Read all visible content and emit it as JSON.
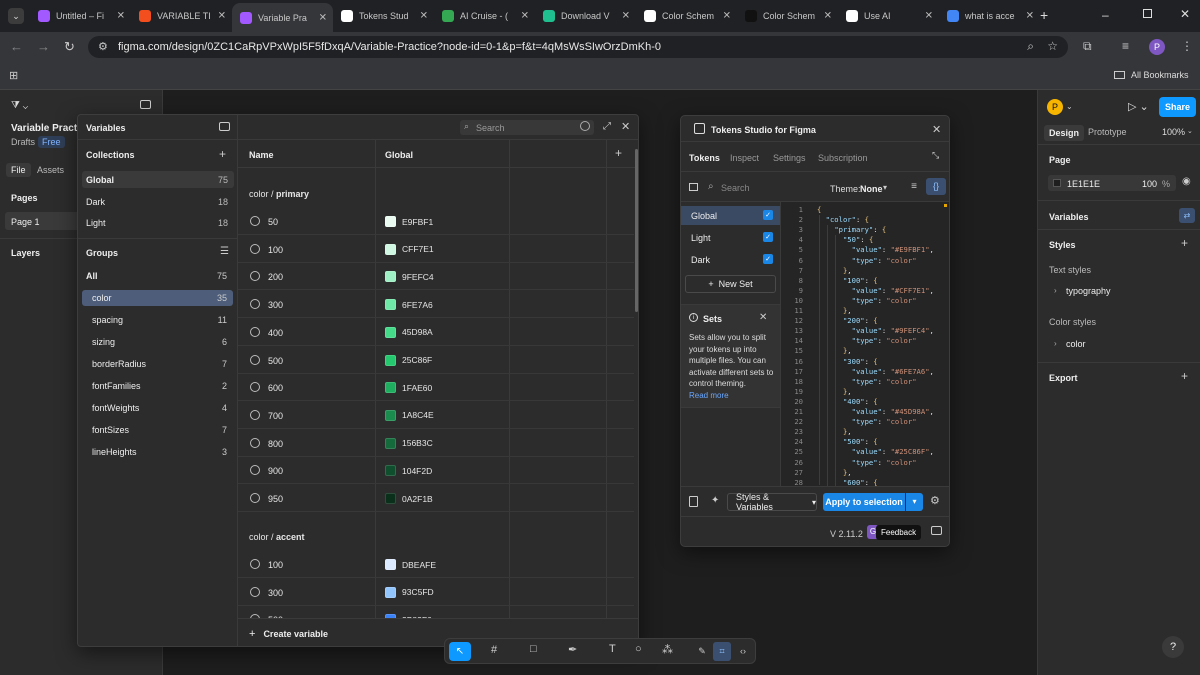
{
  "browser": {
    "tabs": [
      {
        "title": "Untitled – Fi",
        "fav_color": "#a259ff"
      },
      {
        "title": "VARIABLE TI",
        "fav_color": "#f24e1e"
      },
      {
        "title": "Variable Pra",
        "fav_color": "#a259ff",
        "active": true
      },
      {
        "title": "Tokens Stud",
        "fav_color": "#ffffff"
      },
      {
        "title": "AI Cruise - (",
        "fav_color": "#34a853"
      },
      {
        "title": "Download V",
        "fav_color": "#1fbf8f"
      },
      {
        "title": "Color Schem",
        "fav_color": "#ffffff"
      },
      {
        "title": "Color Schem",
        "fav_color": "#111111"
      },
      {
        "title": "Use AI",
        "fav_color": "#ffffff"
      },
      {
        "title": "what is acce",
        "fav_color": "#4285f4"
      }
    ],
    "url": "figma.com/design/0ZC1CaRpVPxWpI5F5fDxqA/Variable-Practice?node-id=0-1&p=f&t=4qMsWsSIwOrzDmKh-0",
    "profile_initial": "P",
    "bookmarks_label": "All Bookmarks"
  },
  "figma_left": {
    "file_name": "Variable Practic",
    "drafts": "Drafts",
    "plan_badge": "Free",
    "tabs": [
      "File",
      "Assets"
    ],
    "pages_label": "Pages",
    "page_item": "Page 1",
    "layers_label": "Layers"
  },
  "variables_modal": {
    "title": "Variables",
    "search_placeholder": "Search",
    "collections_label": "Collections",
    "collections": [
      {
        "name": "Global",
        "count": "75"
      },
      {
        "name": "Dark",
        "count": "18"
      },
      {
        "name": "Light",
        "count": "18"
      }
    ],
    "groups_label": "Groups",
    "groups": [
      {
        "name": "All",
        "count": "75"
      },
      {
        "name": "color",
        "count": "35"
      },
      {
        "name": "spacing",
        "count": "11"
      },
      {
        "name": "sizing",
        "count": "6"
      },
      {
        "name": "borderRadius",
        "count": "7"
      },
      {
        "name": "fontFamilies",
        "count": "2"
      },
      {
        "name": "fontWeights",
        "count": "4"
      },
      {
        "name": "fontSizes",
        "count": "7"
      },
      {
        "name": "lineHeights",
        "count": "3"
      }
    ],
    "col_name": "Name",
    "col_global": "Global",
    "section1_prefix": "color / ",
    "section1_name": "primary",
    "primary": [
      {
        "name": "50",
        "value": "E9FBF1",
        "color": "#E9FBF1"
      },
      {
        "name": "100",
        "value": "CFF7E1",
        "color": "#CFF7E1"
      },
      {
        "name": "200",
        "value": "9FEFC4",
        "color": "#9FEFC4"
      },
      {
        "name": "300",
        "value": "6FE7A6",
        "color": "#6FE7A6"
      },
      {
        "name": "400",
        "value": "45D98A",
        "color": "#45D98A"
      },
      {
        "name": "500",
        "value": "25C86F",
        "color": "#25C86F"
      },
      {
        "name": "600",
        "value": "1FAE60",
        "color": "#1FAE60"
      },
      {
        "name": "700",
        "value": "1A8C4E",
        "color": "#1A8C4E"
      },
      {
        "name": "800",
        "value": "156B3C",
        "color": "#156B3C"
      },
      {
        "name": "900",
        "value": "104F2D",
        "color": "#104F2D"
      },
      {
        "name": "950",
        "value": "0A2F1B",
        "color": "#0A2F1B"
      }
    ],
    "section2_prefix": "color / ",
    "section2_name": "accent",
    "accent": [
      {
        "name": "100",
        "value": "DBEAFE",
        "color": "#DBEAFE"
      },
      {
        "name": "300",
        "value": "93C5FD",
        "color": "#93C5FD"
      },
      {
        "name": "500",
        "value": "3B82F6",
        "color": "#3B82F6"
      }
    ],
    "create_variable": "Create variable"
  },
  "tokens_studio": {
    "title": "Tokens Studio for Figma",
    "tabs": [
      "Tokens",
      "Inspect",
      "Settings",
      "Subscription"
    ],
    "search_placeholder": "Search",
    "theme_label": "Theme:",
    "theme_value": "None",
    "sets": [
      "Global",
      "Light",
      "Dark"
    ],
    "new_set": "New Set",
    "info_title": "Sets",
    "info_text": "Sets allow you to split your tokens up into multiple files. You can activate different sets to control theming.",
    "read_more": "Read more",
    "code_lines": [
      "{",
      "  \"color\": {",
      "    \"primary\": {",
      "      \"50\": {",
      "        \"value\": \"#E9FBF1\",",
      "        \"type\": \"color\"",
      "      },",
      "      \"100\": {",
      "        \"value\": \"#CFF7E1\",",
      "        \"type\": \"color\"",
      "      },",
      "      \"200\": {",
      "        \"value\": \"#9FEFC4\",",
      "        \"type\": \"color\"",
      "      },",
      "      \"300\": {",
      "        \"value\": \"#6FE7A6\",",
      "        \"type\": \"color\"",
      "      },",
      "      \"400\": {",
      "        \"value\": \"#45D98A\",",
      "        \"type\": \"color\"",
      "      },",
      "      \"500\": {",
      "        \"value\": \"#25C86F\",",
      "        \"type\": \"color\"",
      "      },",
      "      \"600\": {"
    ],
    "styles_vars": "Styles & Variables",
    "apply": "Apply to selection",
    "version": "V 2.11.2",
    "feedback": "Feedback"
  },
  "figma_right": {
    "avatar": "P",
    "share": "Share",
    "tabs": [
      "Design",
      "Prototype"
    ],
    "zoom": "100%",
    "page_label": "Page",
    "page_color": "1E1E1E",
    "page_opacity": "100",
    "page_pct": "%",
    "variables_label": "Variables",
    "styles_label": "Styles",
    "text_styles": "Text styles",
    "text_style_item": "typography",
    "color_styles": "Color styles",
    "color_style_item": "color",
    "export_label": "Export"
  },
  "help": "?"
}
